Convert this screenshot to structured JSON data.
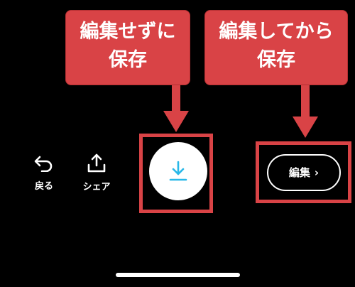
{
  "callouts": {
    "save_without_edit": {
      "line1": "編集せずに",
      "line2": "保存"
    },
    "save_after_edit": {
      "line1": "編集してから",
      "line2": "保存"
    }
  },
  "toolbar": {
    "back_label": "戻る",
    "share_label": "シェア",
    "edit_label": "編集",
    "edit_chevron": "›"
  },
  "icons": {
    "back": "undo-arrow-icon",
    "share": "share-upload-icon",
    "save": "download-icon",
    "edit": "chevron-right-icon"
  },
  "colors": {
    "background": "#000000",
    "annotation_red": "#d94346",
    "save_icon": "#29b8e8",
    "text": "#ffffff"
  }
}
